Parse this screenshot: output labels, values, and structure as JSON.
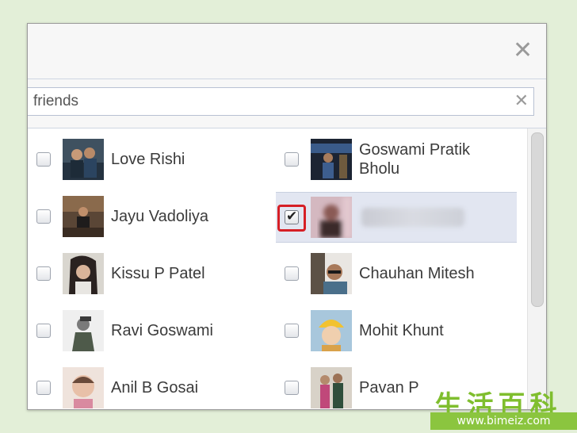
{
  "dialog": {
    "close_glyph": "✕",
    "search": {
      "value": "friends",
      "clear_glyph": "✕"
    }
  },
  "friends": [
    {
      "name": "Love Rishi",
      "checked": false
    },
    {
      "name": "Goswami Pratik Bholu",
      "checked": false
    },
    {
      "name": "Jayu Vadoliya",
      "checked": false
    },
    {
      "name": "",
      "checked": true,
      "name_obscured": true
    },
    {
      "name": "Kissu P Patel",
      "checked": false
    },
    {
      "name": "Chauhan Mitesh",
      "checked": false
    },
    {
      "name": "Ravi Goswami",
      "checked": false
    },
    {
      "name": "Mohit Khunt",
      "checked": false
    },
    {
      "name": "Anil B Gosai",
      "checked": false
    },
    {
      "name": "Pavan P",
      "checked": false
    }
  ],
  "check_glyph": "✔",
  "watermark": {
    "chinese": "生活百科",
    "url": "www.bimeiz.com"
  },
  "colors": {
    "highlight": "#d61f26",
    "selected_row": "#e2e6f1",
    "background": "#e3efd8"
  }
}
